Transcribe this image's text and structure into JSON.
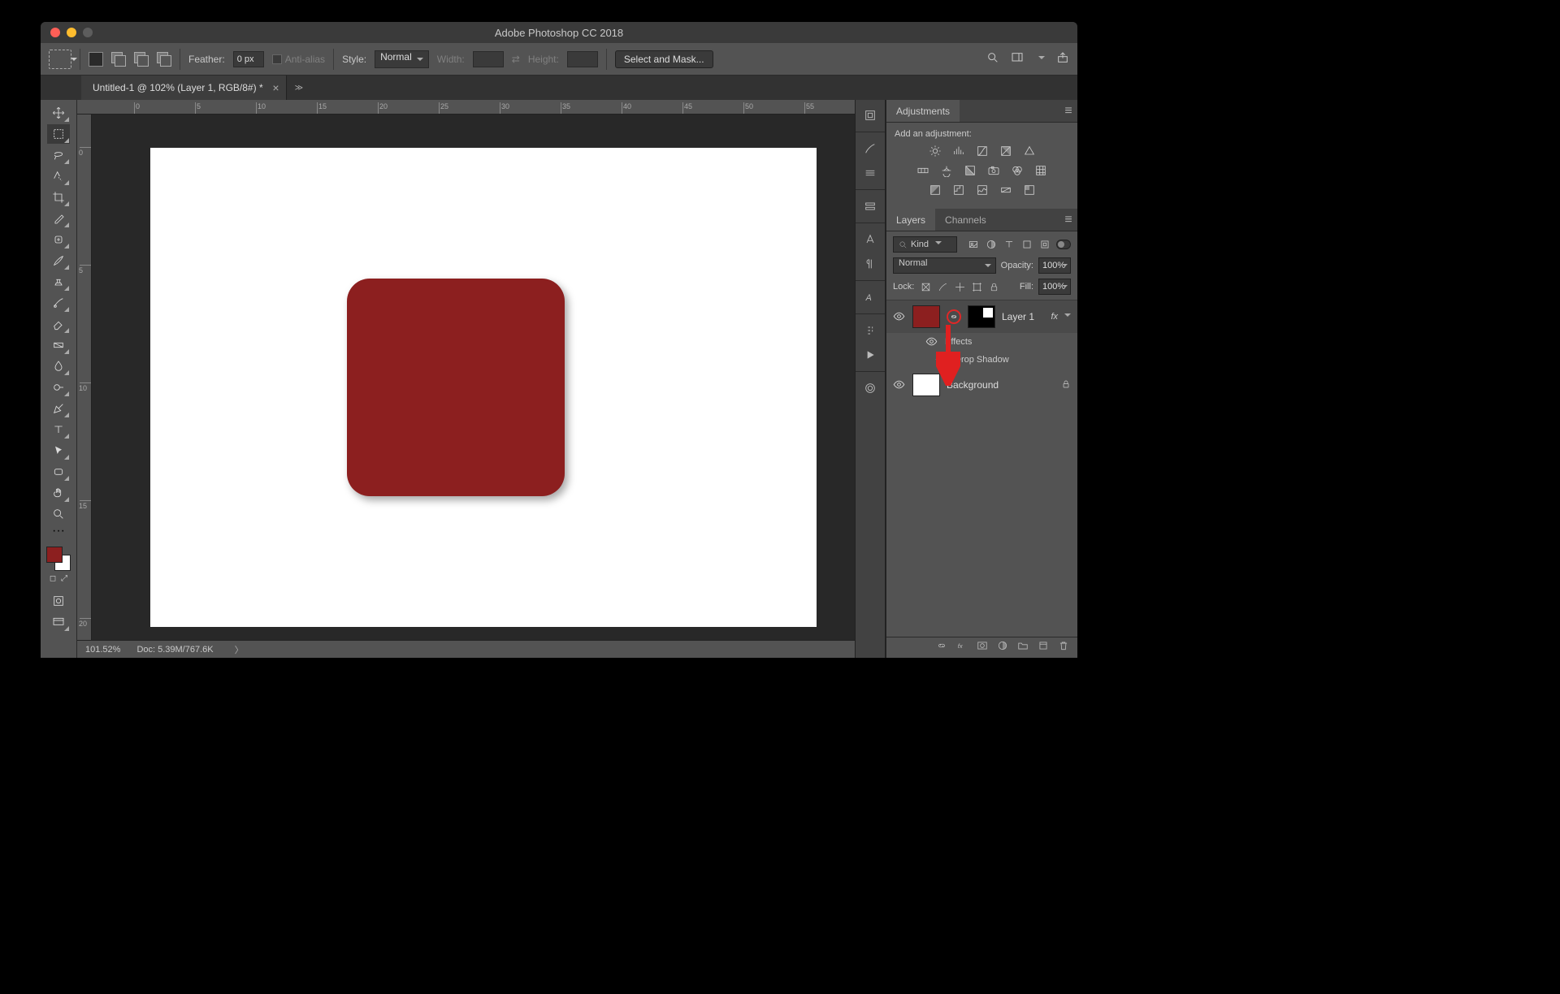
{
  "app": {
    "title": "Adobe Photoshop CC 2018"
  },
  "options": {
    "feather_label": "Feather:",
    "feather_value": "0 px",
    "antialias_label": "Anti-alias",
    "style_label": "Style:",
    "style_value": "Normal",
    "width_label": "Width:",
    "height_label": "Height:",
    "select_mask_label": "Select and Mask..."
  },
  "document": {
    "tab_title": "Untitled-1 @ 102% (Layer 1, RGB/8#) *"
  },
  "status": {
    "zoom": "101.52%",
    "doc_info": "Doc: 5.39M/767.6K"
  },
  "ruler_h": [
    "0",
    "5",
    "10",
    "15",
    "20",
    "25",
    "30",
    "35",
    "40",
    "45",
    "50",
    "55"
  ],
  "ruler_v": [
    "0",
    "5",
    "10",
    "15",
    "20"
  ],
  "adjustments": {
    "tab_label": "Adjustments",
    "heading": "Add an adjustment:"
  },
  "layers": {
    "tab_layers": "Layers",
    "tab_channels": "Channels",
    "filter_kind": "Kind",
    "blend_mode": "Normal",
    "opacity_label": "Opacity:",
    "opacity_value": "100%",
    "lock_label": "Lock:",
    "fill_label": "Fill:",
    "fill_value": "100%",
    "items": {
      "layer1": {
        "name": "Layer 1",
        "fx": "fx",
        "effects": "Effects",
        "drop_shadow": "Drop Shadow"
      },
      "background": {
        "name": "Background"
      }
    }
  },
  "shape": {
    "fill": "#8c1f1f"
  }
}
